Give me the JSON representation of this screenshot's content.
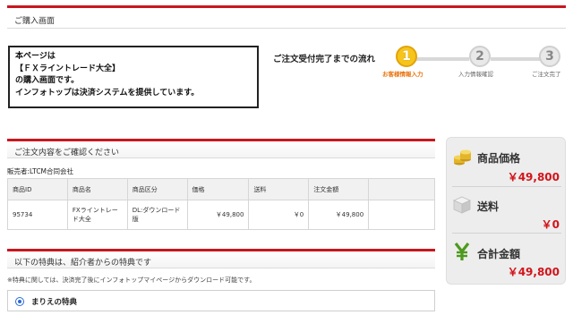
{
  "page": {
    "title": "ご購入画面"
  },
  "intro": {
    "lines": [
      "本ページは",
      "【ＦＸライントレード大全】",
      "の購入画面です。",
      "インフォトップは決済システムを提供しています。"
    ]
  },
  "flow": {
    "title": "ご注文受付完了までの流れ",
    "steps": [
      {
        "num": "1",
        "label": "お客様情報入力",
        "active": true
      },
      {
        "num": "2",
        "label": "入力情報確認",
        "active": false
      },
      {
        "num": "3",
        "label": "ご注文完了",
        "active": false
      }
    ]
  },
  "order": {
    "header": "ご注文内容をご確認ください",
    "seller": "販売者:LTCM合同会社",
    "columns": [
      "商品ID",
      "商品名",
      "商品区分",
      "価格",
      "送料",
      "注文金額"
    ],
    "rows": [
      {
        "id": "95734",
        "name": "FXライントレード大全",
        "category": "DL:ダウンロード版",
        "price": "￥49,800",
        "shipping": "￥0",
        "total": "￥49,800"
      }
    ]
  },
  "bonus": {
    "header": "以下の特典は、紹介者からの特典です",
    "note": "※特典に関しては、決済完了後にインフォトップマイページからダウンロード可能です。",
    "option_label": "まりえの特典"
  },
  "summary": {
    "price_label": "商品価格",
    "price_value": "￥49,800",
    "shipping_label": "送料",
    "shipping_value": "￥0",
    "total_label": "合計金額",
    "total_value": "￥49,800",
    "icons": [
      "coins-icon",
      "box-icon",
      "yen-icon"
    ],
    "accent_color": "#d2141b"
  }
}
